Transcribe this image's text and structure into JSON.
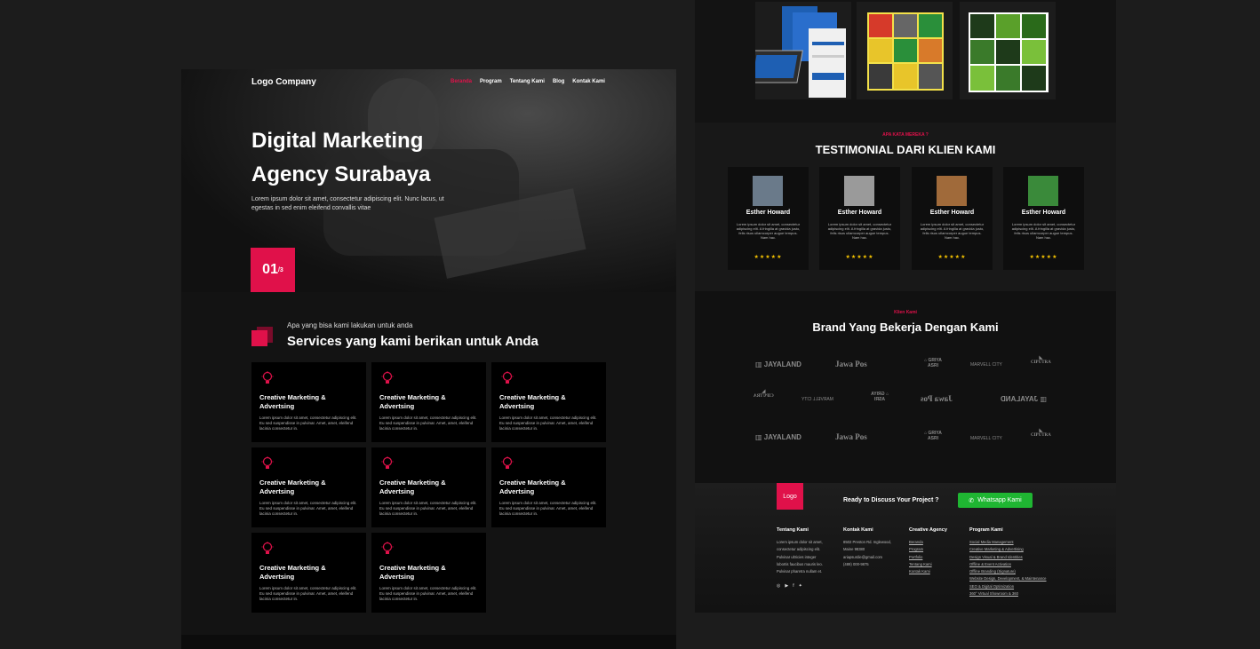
{
  "left": {
    "logo": "Logo Company",
    "nav": [
      "Beranda",
      "Program",
      "Tentang Kami",
      "Blog",
      "Kontak Kami"
    ],
    "hero_title_line1": "Digital Marketing",
    "hero_title_line2": "Agency Surabaya",
    "hero_desc": "Lorem ipsum dolor sit amet, consectetur adipiscing elit. Nunc lacus, ut egestas in sed enim eleifend convallis vitae",
    "slide_current": "01",
    "slide_total": "/3",
    "services_sub": "Apa yang bisa kami lakukan untuk anda",
    "services_title": "Services yang kami berikan untuk Anda",
    "card_title": "Creative Marketing & Advertsing",
    "card_desc": "Lorem ipsum dolor sit amet, consectetur adipiscing elit. Eu sed suspendisse in pulvinar. Amet, amet, eleifend lacinia consectetur in."
  },
  "right": {
    "testi_sub": "APA KATA MEREKA ?",
    "testi_title": "TESTIMONIAL DARI KLIEN KAMI",
    "testimonials": [
      {
        "name": "Esther Howard",
        "text": "Lorem ipsum dolor sit amet, consectetur adipiscing elit. A fringilla at gravida justo, felis risus ullamcorper augue tempus. Nam hac.",
        "stars": "★★★★★"
      },
      {
        "name": "Esther Howard",
        "text": "Lorem ipsum dolor sit amet, consectetur adipiscing elit. A fringilla at gravida justo, felis risus ullamcorper augue tempus. Nam hac.",
        "stars": "★★★★★"
      },
      {
        "name": "Esther Howard",
        "text": "Lorem ipsum dolor sit amet, consectetur adipiscing elit. A fringilla at gravida justo, felis risus ullamcorper augue tempus. Nam hac.",
        "stars": "★★★★★"
      },
      {
        "name": "Esther Howard",
        "text": "Lorem ipsum dolor sit amet, consectetur adipiscing elit. A fringilla at gravida justo, felis risus ullamcorper augue tempus. Nam hac.",
        "stars": "★★★★★"
      }
    ],
    "brand_sub": "Klien Kami",
    "brand_title": "Brand Yang Bekerja Dengan Kami",
    "brands": {
      "jayaland": "JAYALAND",
      "jawapos": "Jawa Pos",
      "griya": "GRIYA ASRI",
      "marvell": "MARVELL CITY",
      "ciputra": "CIPUTRA"
    },
    "footer": {
      "logo": "Logo",
      "ready": "Ready to Discuss Your Project ?",
      "wa_button": "Whatsapp Kami",
      "col1_title": "Tentang Kami",
      "col1_lines": [
        "Lorem ipsum dolor sit amet,",
        "consectetur adipiscing elit.",
        "Pulvinar ultricies integer",
        "lobortis faucibus mauris leo.",
        "Pulvinar pharetra nullam et."
      ],
      "col2_title": "Kontak Kami",
      "col2_lines": [
        "8502 Preston Rd. Inglewood,",
        "Maine 98380",
        "ariapsurdie@gmail.com",
        "(489) 000-9875"
      ],
      "col3_title": "Creative Agency",
      "col3_lines": [
        "Beranda",
        "Program",
        "Portfolio",
        "Tentang Kami",
        "Kontak Kami"
      ],
      "col4_title": "Program Kami",
      "col4_lines": [
        "Social Media Management",
        "Creative Marketing & Advertising",
        "Design Visual & Brand Identities",
        "Offline & Event Activation",
        "Offline Branding (Signature)",
        "Website Design, Development, & Maintenance",
        "SEO & Digital Optimization",
        "360° Virtual Showroom & 360"
      ]
    }
  }
}
